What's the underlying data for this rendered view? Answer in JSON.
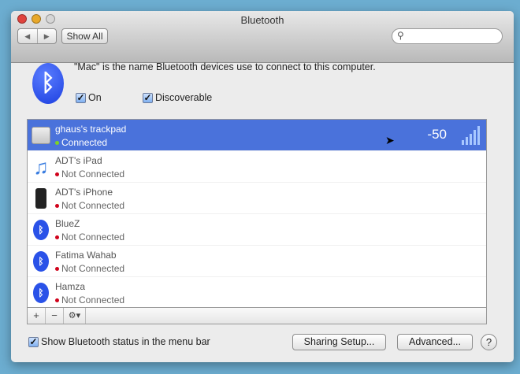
{
  "window": {
    "title": "Bluetooth"
  },
  "toolbar": {
    "back": "◀",
    "forward": "▶",
    "show_all": "Show All",
    "search_placeholder": ""
  },
  "description": "\"Mac\" is the name Bluetooth devices use to connect to this computer.",
  "checkboxes": {
    "on": "On",
    "discoverable": "Discoverable",
    "show_status": "Show Bluetooth status in the menu bar"
  },
  "devices": [
    {
      "name": "ghaus's trackpad",
      "status": "Connected",
      "icon": "trackpad-icon",
      "rssi": "-50",
      "selected": true
    },
    {
      "name": "ADT's iPad",
      "status": "Not Connected",
      "icon": "music-note-icon"
    },
    {
      "name": "ADT's iPhone",
      "status": "Not Connected",
      "icon": "iphone-icon"
    },
    {
      "name": "BlueZ",
      "status": "Not Connected",
      "icon": "bluetooth-icon"
    },
    {
      "name": "Fatima Wahab",
      "status": "Not Connected",
      "icon": "bluetooth-icon"
    },
    {
      "name": "Hamza",
      "status": "Not Connected",
      "icon": "bluetooth-icon"
    }
  ],
  "list_toolbar": {
    "add": "+",
    "remove": "−",
    "gear": "⚙▾"
  },
  "buttons": {
    "sharing": "Sharing Setup...",
    "advanced": "Advanced...",
    "help": "?"
  },
  "colors": {
    "selection": "#4a72db",
    "connected": "#7ed321",
    "not_connected": "#d0021b"
  }
}
